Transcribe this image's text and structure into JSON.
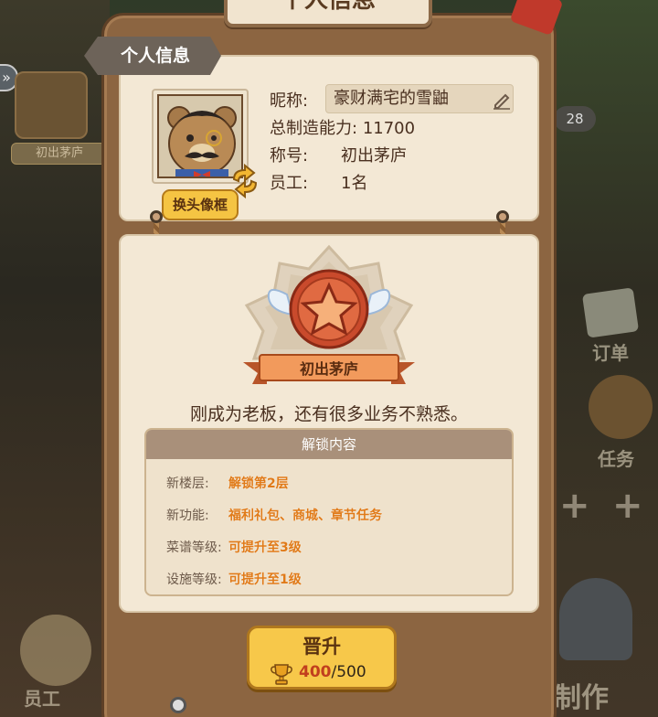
{
  "window": {
    "title": "个人信息"
  },
  "profile_tag": "个人信息",
  "avatar": {
    "change_frame_label": "换头像框"
  },
  "profile": {
    "nickname_label": "昵称:",
    "nickname": "豪财满宅的雪鼬",
    "capacity_label": "总制造能力:",
    "capacity": "11700",
    "title_label": "称号:",
    "title": "初出茅庐",
    "staff_label": "员工:",
    "staff": "1名"
  },
  "rank": {
    "name": "初出茅庐",
    "description": "刚成为老板，还有很多业务不熟悉。"
  },
  "unlock": {
    "header": "解锁内容",
    "rows": [
      {
        "key": "新楼层:",
        "value": "解锁第2层"
      },
      {
        "key": "新功能:",
        "value": "福利礼包、商城、章节任务"
      },
      {
        "key": "菜谱等级:",
        "value": "可提升至3级"
      },
      {
        "key": "设施等级:",
        "value": "可提升至1级"
      }
    ]
  },
  "promote": {
    "label": "晋升",
    "current": "400",
    "required": "/500",
    "progress": 0.8
  },
  "background": {
    "side_title": "初出茅庐",
    "counter": "28",
    "order_label": "订单",
    "task_label": "任务",
    "staff_label": "员工",
    "make_label": "制作"
  },
  "colors": {
    "panel": "#8c6541",
    "card": "#f3e8d5",
    "accent_gold": "#f7c84a",
    "highlight_orange": "#e07a18",
    "ribbon_red": "#d9733e"
  }
}
